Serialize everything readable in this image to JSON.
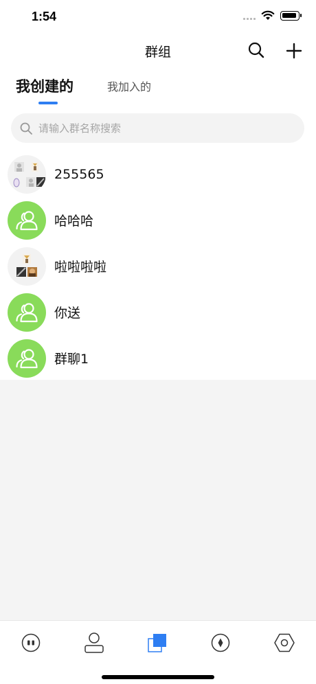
{
  "status_bar": {
    "time": "1:54"
  },
  "header": {
    "title": "群组"
  },
  "tabs": [
    {
      "label": "我创建的",
      "active": true
    },
    {
      "label": "我加入的",
      "active": false
    }
  ],
  "search": {
    "placeholder": "请输入群名称搜索"
  },
  "groups": [
    {
      "name": "255565",
      "avatar": "photo-collage"
    },
    {
      "name": "哈哈哈",
      "avatar": "group-people-icon"
    },
    {
      "name": "啦啦啦啦",
      "avatar": "photo-collage"
    },
    {
      "name": "你送",
      "avatar": "group-people-icon"
    },
    {
      "name": "群聊1",
      "avatar": "group-people-icon"
    }
  ],
  "colors": {
    "accent": "#2e7ef2",
    "avatar_green": "#89db5a",
    "search_bg": "#f3f3f3",
    "page_bg": "#f4f4f4"
  },
  "bottom_nav": [
    {
      "icon": "message-bubble-icon",
      "active": false
    },
    {
      "icon": "contacts-person-icon",
      "active": false
    },
    {
      "icon": "groups-squares-icon",
      "active": true
    },
    {
      "icon": "discover-compass-icon",
      "active": false
    },
    {
      "icon": "settings-hexagon-icon",
      "active": false
    }
  ]
}
